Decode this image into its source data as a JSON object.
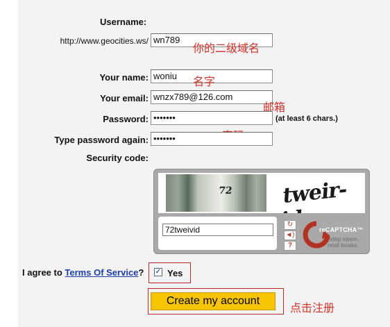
{
  "form": {
    "username_label": "Username:",
    "url_prefix": "http://www.geocities.ws/",
    "username_value": "wn789",
    "username_note": "你的二级域名",
    "name_label": "Your name:",
    "name_value": "woniu",
    "name_note": "名字",
    "email_label": "Your email:",
    "email_value": "wnzx789@126.com",
    "email_note": "邮箱",
    "password_label": "Password:",
    "password_value": "•••••••",
    "password_hint": "(at least 6 chars.)",
    "password_note": "密码",
    "password2_label": "Type password again:",
    "password2_value": "•••••••",
    "security_label": "Security code:"
  },
  "recaptcha": {
    "word1": "72",
    "word2": "tweir-id",
    "response_value": "72tweivid",
    "reload_icon": "reload-icon",
    "audio_icon": "audio-icon",
    "help_icon": "help-icon",
    "logo_text": "reCAPTCHA™",
    "slogan_line1": "stop spam.",
    "slogan_line2": "read books."
  },
  "agree": {
    "prefix": "I agree to",
    "tos_link": "Terms Of Service",
    "suffix": "?",
    "checked": true,
    "checkbox_mark": "✓",
    "yes_label": "Yes"
  },
  "submit": {
    "label": "Create my account",
    "note": "点击注册"
  },
  "colors": {
    "annotation": "#d2302a",
    "button": "#f6c400",
    "link": "#1a3fa8"
  }
}
